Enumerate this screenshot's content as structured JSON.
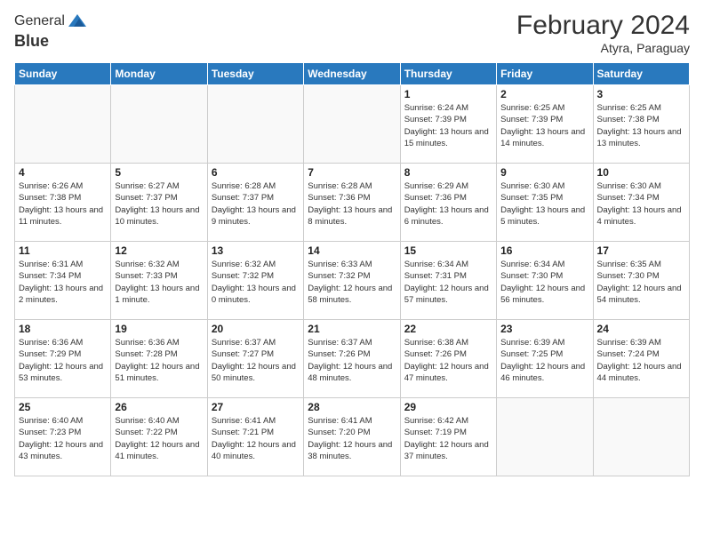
{
  "header": {
    "logo_general": "General",
    "logo_blue": "Blue",
    "month_year": "February 2024",
    "location": "Atyra, Paraguay"
  },
  "weekdays": [
    "Sunday",
    "Monday",
    "Tuesday",
    "Wednesday",
    "Thursday",
    "Friday",
    "Saturday"
  ],
  "weeks": [
    [
      {
        "day": "",
        "info": ""
      },
      {
        "day": "",
        "info": ""
      },
      {
        "day": "",
        "info": ""
      },
      {
        "day": "",
        "info": ""
      },
      {
        "day": "1",
        "info": "Sunrise: 6:24 AM\nSunset: 7:39 PM\nDaylight: 13 hours\nand 15 minutes."
      },
      {
        "day": "2",
        "info": "Sunrise: 6:25 AM\nSunset: 7:39 PM\nDaylight: 13 hours\nand 14 minutes."
      },
      {
        "day": "3",
        "info": "Sunrise: 6:25 AM\nSunset: 7:38 PM\nDaylight: 13 hours\nand 13 minutes."
      }
    ],
    [
      {
        "day": "4",
        "info": "Sunrise: 6:26 AM\nSunset: 7:38 PM\nDaylight: 13 hours\nand 11 minutes."
      },
      {
        "day": "5",
        "info": "Sunrise: 6:27 AM\nSunset: 7:37 PM\nDaylight: 13 hours\nand 10 minutes."
      },
      {
        "day": "6",
        "info": "Sunrise: 6:28 AM\nSunset: 7:37 PM\nDaylight: 13 hours\nand 9 minutes."
      },
      {
        "day": "7",
        "info": "Sunrise: 6:28 AM\nSunset: 7:36 PM\nDaylight: 13 hours\nand 8 minutes."
      },
      {
        "day": "8",
        "info": "Sunrise: 6:29 AM\nSunset: 7:36 PM\nDaylight: 13 hours\nand 6 minutes."
      },
      {
        "day": "9",
        "info": "Sunrise: 6:30 AM\nSunset: 7:35 PM\nDaylight: 13 hours\nand 5 minutes."
      },
      {
        "day": "10",
        "info": "Sunrise: 6:30 AM\nSunset: 7:34 PM\nDaylight: 13 hours\nand 4 minutes."
      }
    ],
    [
      {
        "day": "11",
        "info": "Sunrise: 6:31 AM\nSunset: 7:34 PM\nDaylight: 13 hours\nand 2 minutes."
      },
      {
        "day": "12",
        "info": "Sunrise: 6:32 AM\nSunset: 7:33 PM\nDaylight: 13 hours\nand 1 minute."
      },
      {
        "day": "13",
        "info": "Sunrise: 6:32 AM\nSunset: 7:32 PM\nDaylight: 13 hours\nand 0 minutes."
      },
      {
        "day": "14",
        "info": "Sunrise: 6:33 AM\nSunset: 7:32 PM\nDaylight: 12 hours\nand 58 minutes."
      },
      {
        "day": "15",
        "info": "Sunrise: 6:34 AM\nSunset: 7:31 PM\nDaylight: 12 hours\nand 57 minutes."
      },
      {
        "day": "16",
        "info": "Sunrise: 6:34 AM\nSunset: 7:30 PM\nDaylight: 12 hours\nand 56 minutes."
      },
      {
        "day": "17",
        "info": "Sunrise: 6:35 AM\nSunset: 7:30 PM\nDaylight: 12 hours\nand 54 minutes."
      }
    ],
    [
      {
        "day": "18",
        "info": "Sunrise: 6:36 AM\nSunset: 7:29 PM\nDaylight: 12 hours\nand 53 minutes."
      },
      {
        "day": "19",
        "info": "Sunrise: 6:36 AM\nSunset: 7:28 PM\nDaylight: 12 hours\nand 51 minutes."
      },
      {
        "day": "20",
        "info": "Sunrise: 6:37 AM\nSunset: 7:27 PM\nDaylight: 12 hours\nand 50 minutes."
      },
      {
        "day": "21",
        "info": "Sunrise: 6:37 AM\nSunset: 7:26 PM\nDaylight: 12 hours\nand 48 minutes."
      },
      {
        "day": "22",
        "info": "Sunrise: 6:38 AM\nSunset: 7:26 PM\nDaylight: 12 hours\nand 47 minutes."
      },
      {
        "day": "23",
        "info": "Sunrise: 6:39 AM\nSunset: 7:25 PM\nDaylight: 12 hours\nand 46 minutes."
      },
      {
        "day": "24",
        "info": "Sunrise: 6:39 AM\nSunset: 7:24 PM\nDaylight: 12 hours\nand 44 minutes."
      }
    ],
    [
      {
        "day": "25",
        "info": "Sunrise: 6:40 AM\nSunset: 7:23 PM\nDaylight: 12 hours\nand 43 minutes."
      },
      {
        "day": "26",
        "info": "Sunrise: 6:40 AM\nSunset: 7:22 PM\nDaylight: 12 hours\nand 41 minutes."
      },
      {
        "day": "27",
        "info": "Sunrise: 6:41 AM\nSunset: 7:21 PM\nDaylight: 12 hours\nand 40 minutes."
      },
      {
        "day": "28",
        "info": "Sunrise: 6:41 AM\nSunset: 7:20 PM\nDaylight: 12 hours\nand 38 minutes."
      },
      {
        "day": "29",
        "info": "Sunrise: 6:42 AM\nSunset: 7:19 PM\nDaylight: 12 hours\nand 37 minutes."
      },
      {
        "day": "",
        "info": ""
      },
      {
        "day": "",
        "info": ""
      }
    ]
  ]
}
